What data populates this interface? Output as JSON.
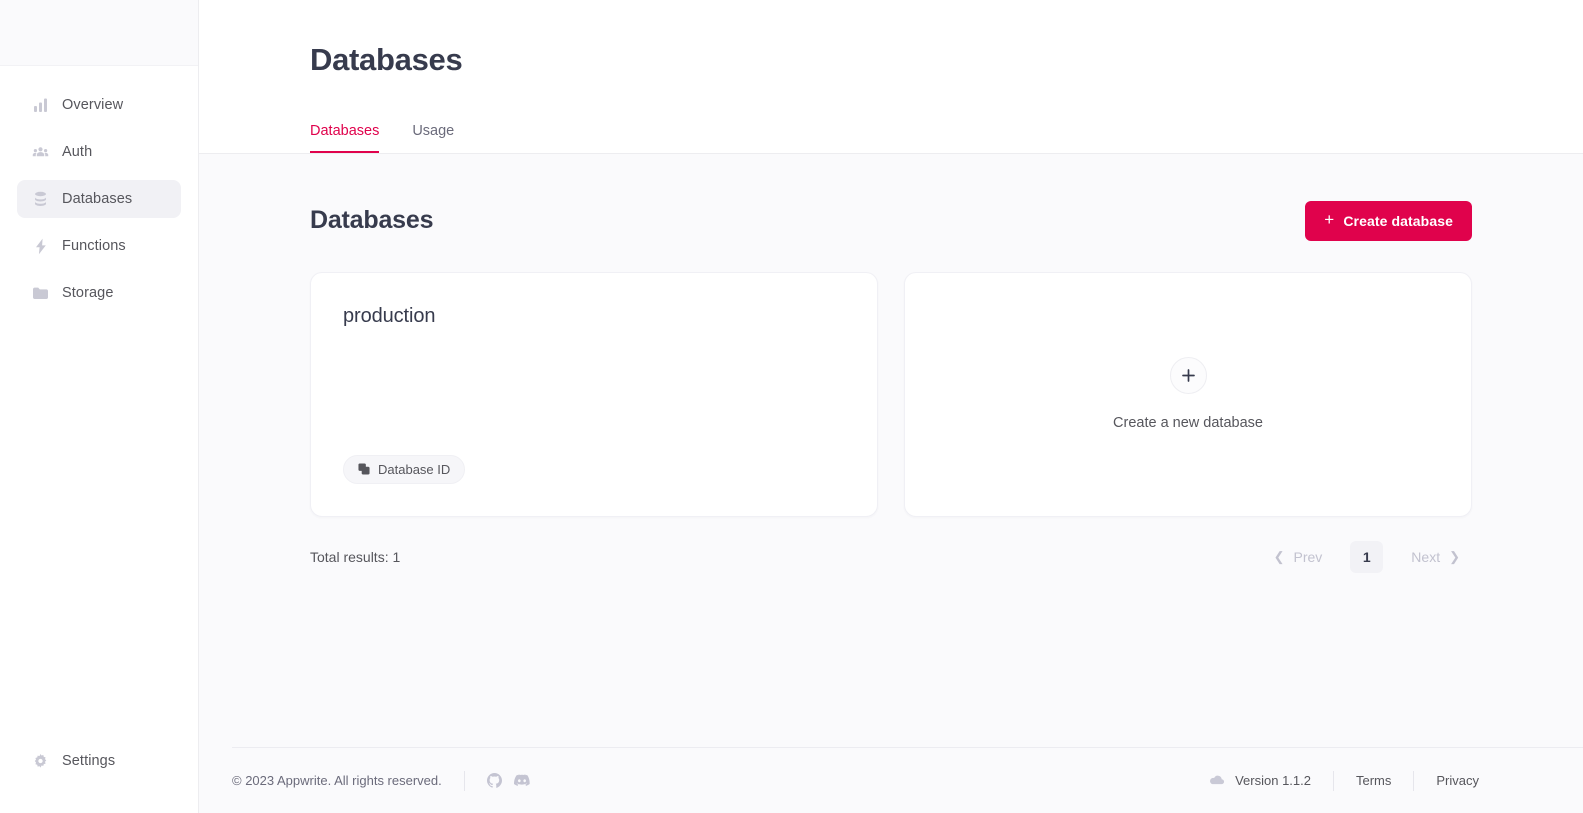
{
  "sidebar": {
    "items": [
      {
        "label": "Overview",
        "icon": "bar-chart-icon",
        "active": false
      },
      {
        "label": "Auth",
        "icon": "users-icon",
        "active": false
      },
      {
        "label": "Databases",
        "icon": "database-icon",
        "active": true
      },
      {
        "label": "Functions",
        "icon": "lightning-bolt-icon",
        "active": false
      },
      {
        "label": "Storage",
        "icon": "folder-icon",
        "active": false
      }
    ],
    "settings": {
      "label": "Settings",
      "icon": "gear-icon"
    }
  },
  "header": {
    "title": "Databases",
    "tabs": [
      {
        "label": "Databases",
        "active": true
      },
      {
        "label": "Usage",
        "active": false
      }
    ]
  },
  "main": {
    "section_title": "Databases",
    "create_button": {
      "label": "Create database",
      "icon": "plus-icon"
    },
    "databases": [
      {
        "name": "production",
        "chip_label": "Database ID",
        "chip_icon": "copy-icon"
      }
    ],
    "new_card": {
      "label": "Create a new database",
      "icon": "plus-icon"
    },
    "total_results": "Total results: 1",
    "pagination": {
      "prev_label": "Prev",
      "next_label": "Next",
      "current_page": "1",
      "prev_icon": "chevron-left-icon",
      "next_icon": "chevron-right-icon"
    }
  },
  "footer": {
    "copyright": "© 2023 Appwrite. All rights reserved.",
    "social": [
      {
        "name": "github-icon"
      },
      {
        "name": "discord-icon"
      }
    ],
    "version": "Version 1.1.2",
    "version_icon": "cloud-icon",
    "links": [
      {
        "label": "Terms"
      },
      {
        "label": "Privacy"
      }
    ]
  },
  "colors": {
    "accent": "#e0024c",
    "text": "#373b4d",
    "muted": "#56565c",
    "page_bg": "#fafafc",
    "card_bg": "#ffffff"
  }
}
